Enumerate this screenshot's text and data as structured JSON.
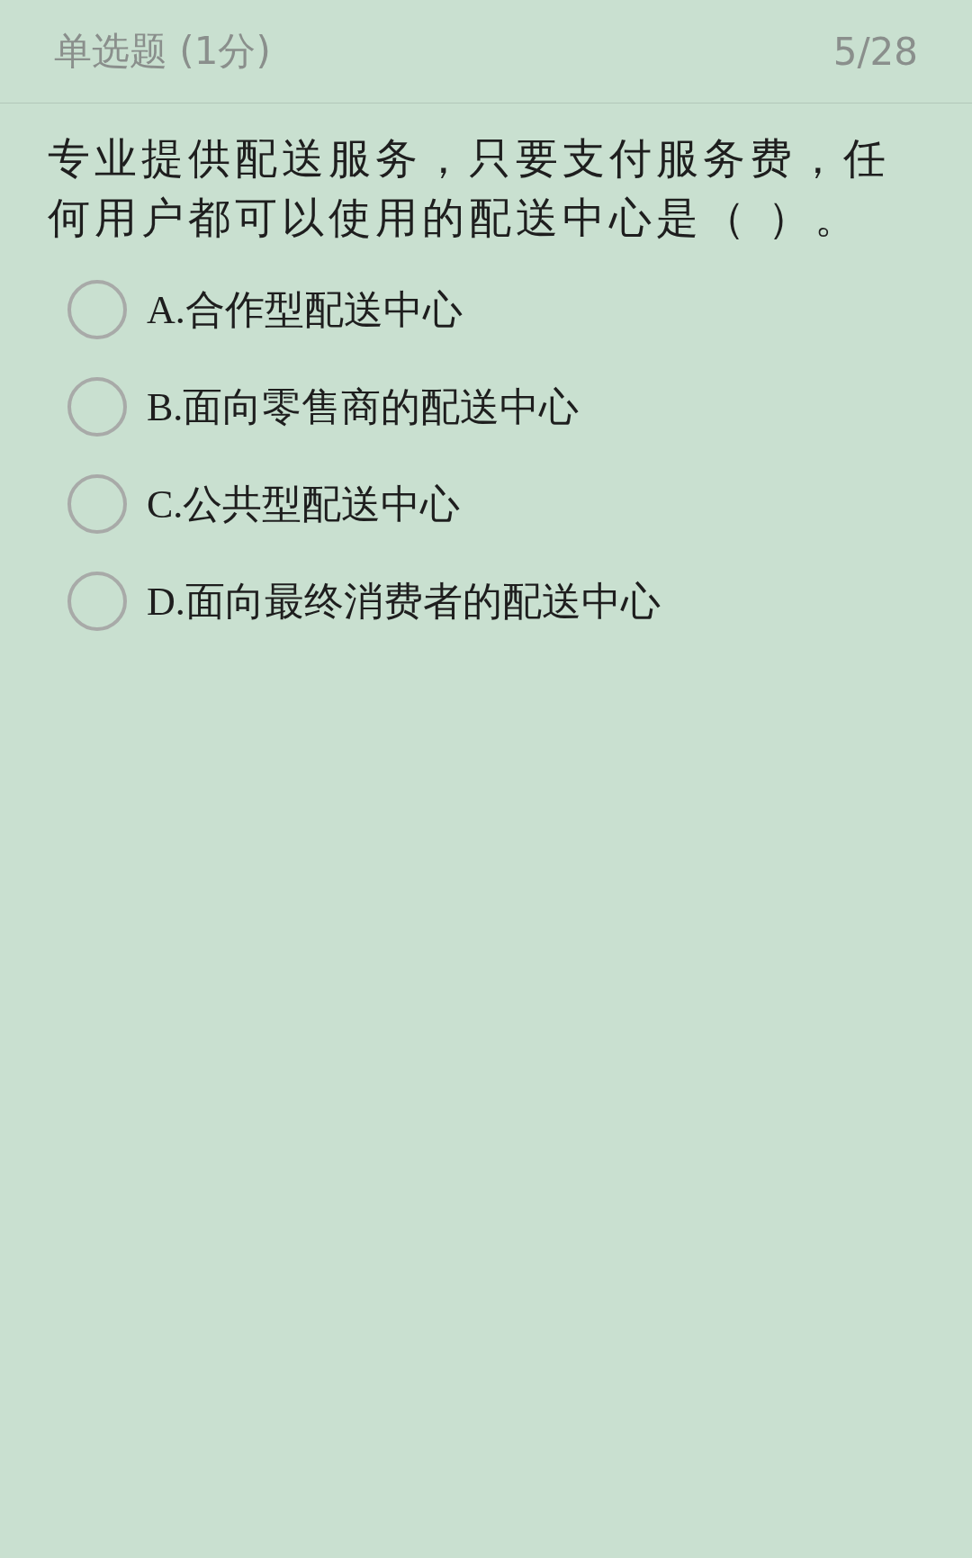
{
  "header": {
    "question_type": "单选题 (1分)",
    "progress": "5/28"
  },
  "question": "专业提供配送服务，只要支付服务费，任何用户都可以使用的配送中心是（ ）。",
  "options": [
    {
      "label": "A.合作型配送中心",
      "selected": false
    },
    {
      "label": "B.面向零售商的配送中心",
      "selected": false
    },
    {
      "label": "C.公共型配送中心",
      "selected": false
    },
    {
      "label": "D.面向最终消费者的配送中心",
      "selected": false
    }
  ]
}
